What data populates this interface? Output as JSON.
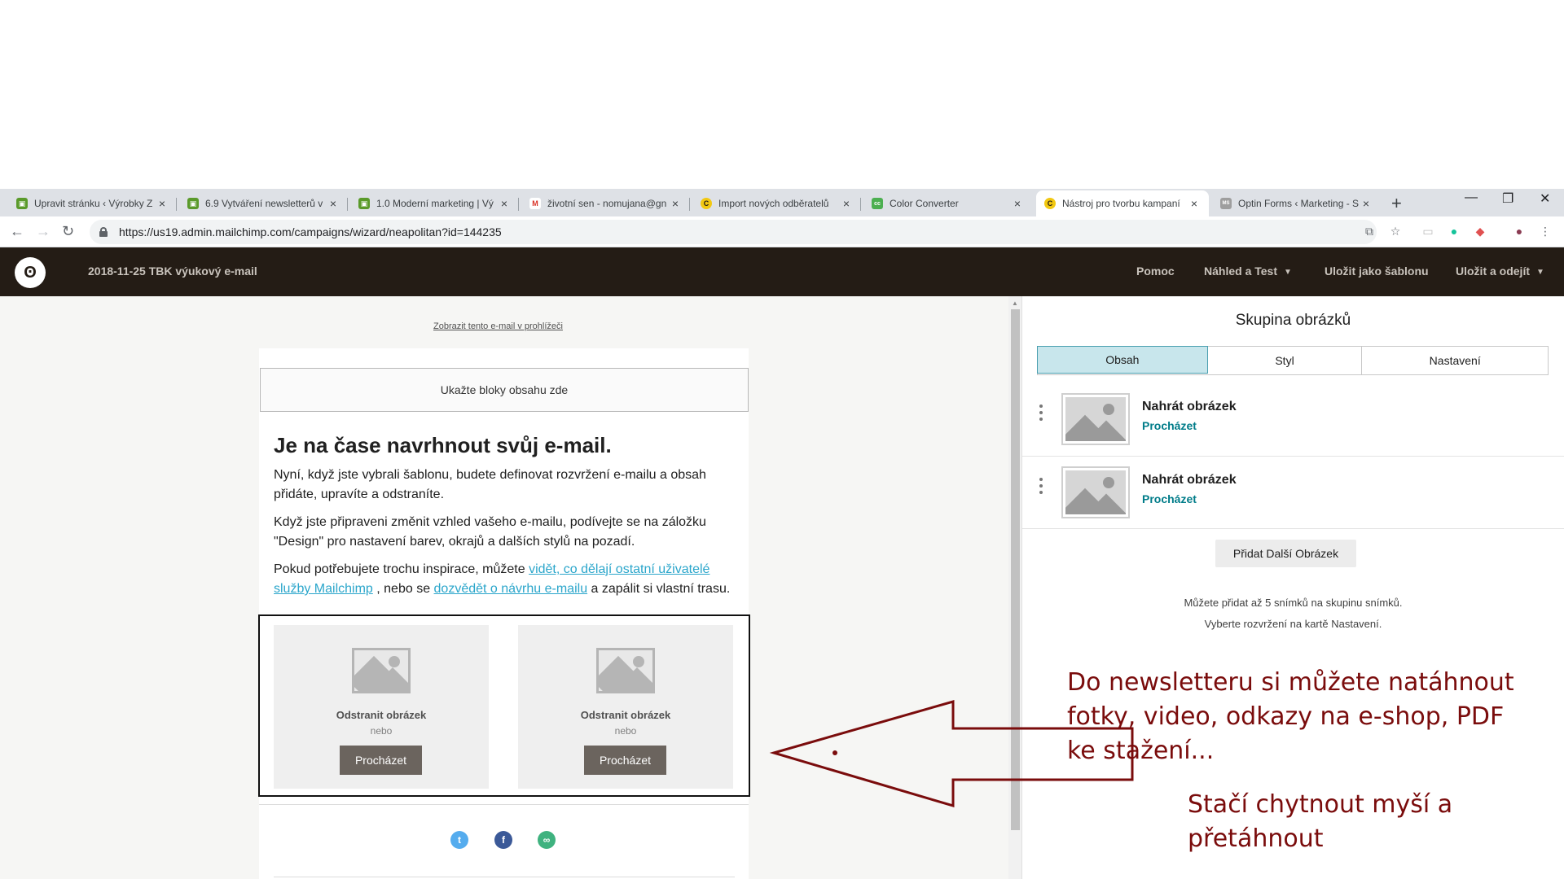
{
  "browser": {
    "tabs": [
      {
        "title": "Upravit stránku ‹ Výrobky Z",
        "color": "#5a9a2a",
        "glyph": "▣"
      },
      {
        "title": "6.9 Vytváření newsletterů v",
        "color": "#5a9a2a",
        "glyph": "▣"
      },
      {
        "title": "1.0 Moderní marketing | Vý",
        "color": "#5a9a2a",
        "glyph": "▣"
      },
      {
        "title": "životní sen - nomujana@gn",
        "color": "#d93025",
        "glyph": "M"
      },
      {
        "title": "Import nových odběratelů",
        "color": "#f2c811",
        "glyph": "C"
      },
      {
        "title": "Color Converter",
        "color": "#4caf50",
        "glyph": "cc"
      },
      {
        "title": "Nástroj pro tvorbu kampaní",
        "color": "#f2c811",
        "glyph": "C"
      },
      {
        "title": "Optin Forms ‹ Marketing - S",
        "color": "#9e9e9e",
        "glyph": "MS"
      }
    ],
    "active_tab_index": 6,
    "url": "https://us19.admin.mailchimp.com/campaigns/wizard/neapolitan?id=144235"
  },
  "app": {
    "campaign_title": "2018-11-25 TBK výukový e-mail",
    "nav": {
      "help": "Pomoc",
      "preview": "Náhled a Test",
      "save_template": "Uložit jako šablonu",
      "save_exit": "Uložit a odejít"
    }
  },
  "email": {
    "view_in_browser": "Zobrazit tento e-mail v prohlížeči",
    "dropzone": "Ukažte bloky obsahu zde",
    "headline": "Je na čase navrhnout svůj e-mail.",
    "p1": "Nyní, když jste vybrali šablonu, budete definovat rozvržení e-mailu a obsah přidáte, upravíte a odstraníte.",
    "p2": "Když jste připraveni změnit vzhled vašeho e-mailu, podívejte se na záložku \"Design\" pro nastavení barev, okrajů a dalších stylů na pozadí.",
    "p3_start": "Pokud potřebujete trochu inspirace, můžete ",
    "p3_link1": "vidět, co dělají ostatní uživatelé služby Mailchimp",
    "p3_mid": " , nebo se ",
    "p3_link2": "dozvědět o návrhu e-mailu",
    "p3_end": " a zapálit si vlastní trasu.",
    "image_cards": [
      {
        "remove": "Odstranit obrázek",
        "or": "nebo",
        "browse": "Procházet"
      },
      {
        "remove": "Odstranit obrázek",
        "or": "nebo",
        "browse": "Procházet"
      }
    ],
    "social_icons": [
      "twitter-icon",
      "facebook-icon",
      "link-icon"
    ]
  },
  "panel": {
    "title": "Skupina obrázků",
    "tabs": [
      "Obsah",
      "Styl",
      "Nastavení"
    ],
    "active_tab": "Obsah",
    "items": [
      {
        "title": "Nahrát obrázek",
        "link": "Procházet"
      },
      {
        "title": "Nahrát obrázek",
        "link": "Procházet"
      }
    ],
    "add_button": "Přidat Další Obrázek",
    "note1": "Můžete přidat až 5 snímků na skupinu snímků.",
    "note2": "Vyberte rozvržení na kartě Nastavení."
  },
  "annotation": {
    "text1_line1": "Do newsletteru si můžete natáhnout",
    "text1_line2": "fotky, video, odkazy na e-shop, PDF",
    "text1_line3": "ke stažení...",
    "text2_line1": "Stačí chytnout myší a",
    "text2_line2": "přetáhnout",
    "color": "#7a0c0c"
  }
}
